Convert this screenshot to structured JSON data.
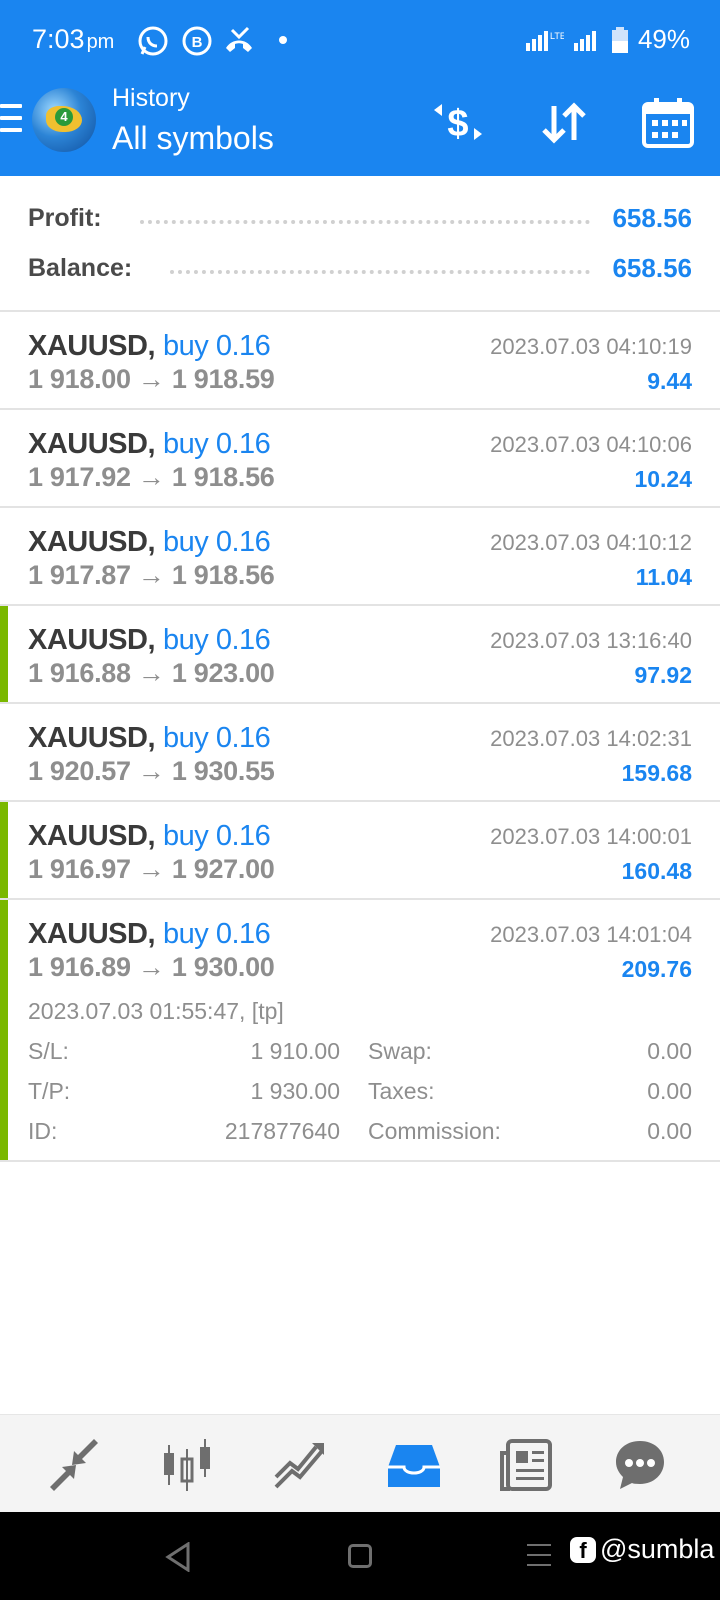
{
  "status_bar": {
    "time": "7:03",
    "ampm": "pm",
    "battery": "49%"
  },
  "header": {
    "subtitle": "History",
    "title": "All symbols"
  },
  "summary": {
    "profit_label": "Profit:",
    "profit_value": "658.56",
    "balance_label": "Balance:",
    "balance_value": "658.56"
  },
  "trades": [
    {
      "symbol": "XAUUSD,",
      "side": "buy 0.16",
      "open": "1 918.00",
      "close": "1 918.59",
      "time": "2023.07.03 04:10:19",
      "profit": "9.44",
      "marked": false
    },
    {
      "symbol": "XAUUSD,",
      "side": "buy 0.16",
      "open": "1 917.92",
      "close": "1 918.56",
      "time": "2023.07.03 04:10:06",
      "profit": "10.24",
      "marked": false
    },
    {
      "symbol": "XAUUSD,",
      "side": "buy 0.16",
      "open": "1 917.87",
      "close": "1 918.56",
      "time": "2023.07.03 04:10:12",
      "profit": "11.04",
      "marked": false
    },
    {
      "symbol": "XAUUSD,",
      "side": "buy 0.16",
      "open": "1 916.88",
      "close": "1 923.00",
      "time": "2023.07.03 13:16:40",
      "profit": "97.92",
      "marked": true
    },
    {
      "symbol": "XAUUSD,",
      "side": "buy 0.16",
      "open": "1 920.57",
      "close": "1 930.55",
      "time": "2023.07.03 14:02:31",
      "profit": "159.68",
      "marked": false
    },
    {
      "symbol": "XAUUSD,",
      "side": "buy 0.16",
      "open": "1 916.97",
      "close": "1 927.00",
      "time": "2023.07.03 14:00:01",
      "profit": "160.48",
      "marked": true
    },
    {
      "symbol": "XAUUSD,",
      "side": "buy 0.16",
      "open": "1 916.89",
      "close": "1 930.00",
      "time": "2023.07.03 14:01:04",
      "profit": "209.76",
      "marked": true
    }
  ],
  "arrow": "→",
  "expanded_detail": {
    "open_info": "2023.07.03 01:55:47, [tp]",
    "sl_label": "S/L:",
    "sl_value": "1 910.00",
    "tp_label": "T/P:",
    "tp_value": "1 930.00",
    "id_label": "ID:",
    "id_value": "217877640",
    "swap_label": "Swap:",
    "swap_value": "0.00",
    "taxes_label": "Taxes:",
    "taxes_value": "0.00",
    "commission_label": "Commission:",
    "commission_value": "0.00"
  },
  "watermark": "@sumbla",
  "colors": {
    "accent": "#1a85f0",
    "marker": "#7ab800",
    "muted": "#8e8e8e"
  },
  "icons": {
    "toolbar": [
      "currency-exchange-icon",
      "sort-icon",
      "calendar-icon"
    ],
    "tabs": [
      "quotes-icon",
      "chart-icon",
      "trade-icon",
      "history-icon",
      "news-icon",
      "chat-icon"
    ]
  }
}
